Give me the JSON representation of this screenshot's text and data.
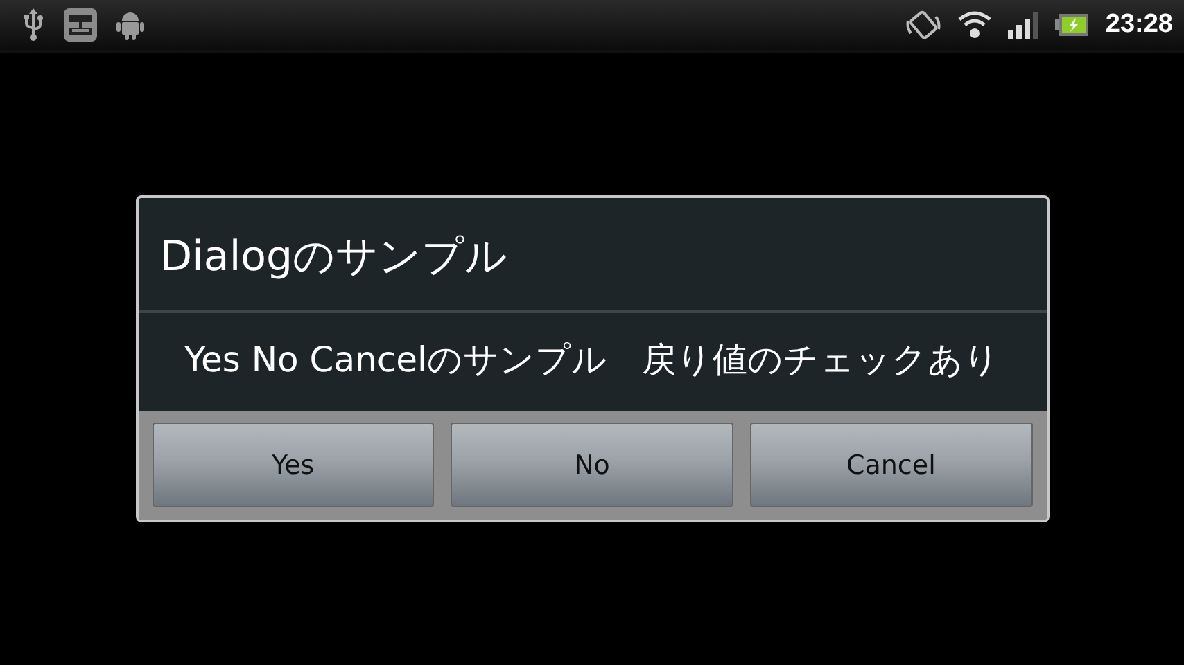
{
  "status_bar": {
    "time": "23:28"
  },
  "dialog": {
    "title": "Dialogのサンプル",
    "message": "Yes No Cancelのサンプル　戻り値のチェックあり",
    "buttons": [
      "Yes",
      "No",
      "Cancel"
    ]
  }
}
